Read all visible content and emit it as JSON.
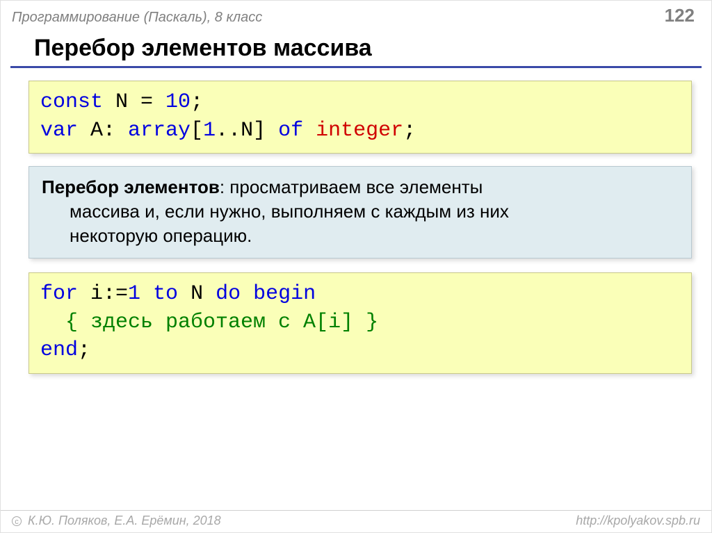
{
  "header": {
    "course": "Программирование (Паскаль), 8 класс",
    "page": "122"
  },
  "title": "Перебор элементов массива",
  "code1": {
    "l1_const": "const",
    "l1_n": " N ",
    "l1_eq": "=",
    "l1_val": " 10",
    "l1_semi": ";",
    "l2_var": "var",
    "l2_a": " A: ",
    "l2_array": "array",
    "l2_br1": "[",
    "l2_one": "1",
    "l2_dd": "..N] ",
    "l2_of": "of",
    "l2_sp": " ",
    "l2_int": "integer",
    "l2_semi": ";"
  },
  "definition": {
    "bold": "Перебор элементов",
    "line1_rest": ": просматриваем все элементы",
    "line2": "массива и, если нужно, выполняем с каждым из них",
    "line3": "некоторую операцию."
  },
  "code2": {
    "l1_for": "for",
    "l1_mid": " i:=",
    "l1_one": "1",
    "l1_to": " to",
    "l1_n": " N ",
    "l1_do": "do",
    "l1_sp": " ",
    "l1_begin": "begin",
    "l2_comment": "  { здесь работаем с A[i] }",
    "l3_end": "end",
    "l3_semi": ";"
  },
  "footer": {
    "copy_symbol": "с",
    "authors": " К.Ю. Поляков, Е.А. Ерёмин, 2018",
    "url": "http://kpolyakov.spb.ru"
  }
}
